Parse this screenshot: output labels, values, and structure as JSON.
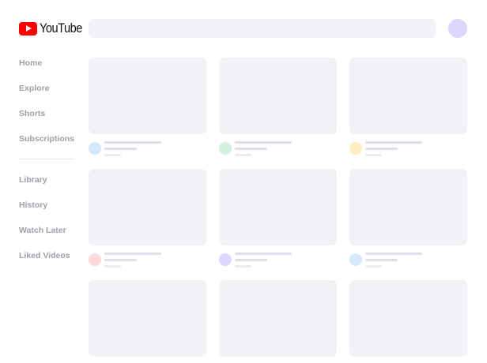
{
  "header": {
    "logo_text": "YouTube",
    "logo_icon": "youtube-play-icon",
    "search_placeholder": "",
    "avatar_color": "#ddd6fe"
  },
  "sidebar": {
    "primary": [
      {
        "label": "Home"
      },
      {
        "label": "Explore"
      },
      {
        "label": "Shorts"
      },
      {
        "label": "Subscriptions"
      }
    ],
    "secondary": [
      {
        "label": "Library"
      },
      {
        "label": "History"
      },
      {
        "label": "Watch Later"
      },
      {
        "label": "Liked Videos"
      }
    ]
  },
  "colors": {
    "brand": "#ff0000",
    "skeleton": "#f1f2f6",
    "nav_text": "#9ca0a8"
  },
  "videos": [
    {
      "channel_color": "#d5e8fb"
    },
    {
      "channel_color": "#d3efdc"
    },
    {
      "channel_color": "#fdefc4"
    },
    {
      "channel_color": "#fbd9d9"
    },
    {
      "channel_color": "#ddd6fe"
    },
    {
      "channel_color": "#d5e8fb"
    },
    {
      "channel_color": null
    },
    {
      "channel_color": null
    },
    {
      "channel_color": null
    }
  ]
}
